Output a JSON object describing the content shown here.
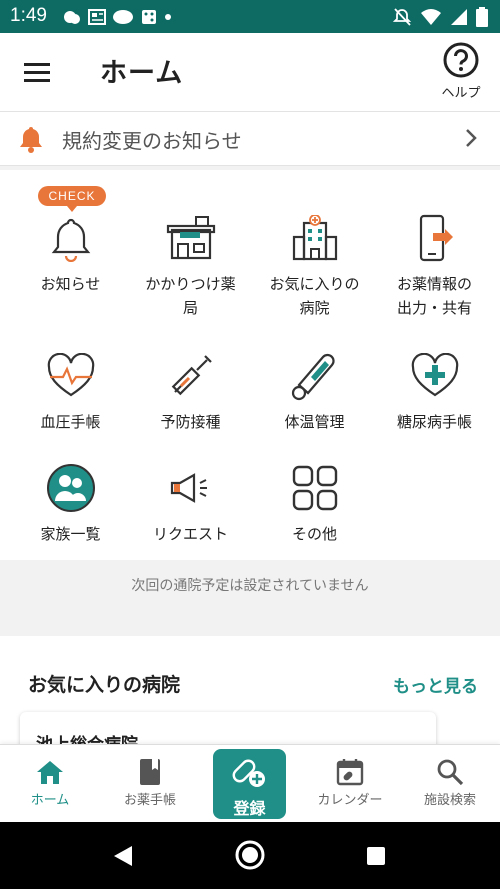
{
  "status_bar": {
    "time": "1:49"
  },
  "app_bar": {
    "title": "ホーム",
    "help_label": "ヘルプ"
  },
  "notice": {
    "text": "規約変更のお知らせ"
  },
  "check_badge": "CHECK",
  "menu": {
    "items": [
      {
        "label": "お知らせ",
        "icon": "bell-icon"
      },
      {
        "label": "かかりつけ薬\n局",
        "icon": "pharmacy-icon"
      },
      {
        "label": "お気に入りの\n病院",
        "icon": "hospital-icon"
      },
      {
        "label": "お薬情報の\n出力・共有",
        "icon": "share-phone-icon"
      },
      {
        "label": "血圧手帳",
        "icon": "heart-pulse-icon"
      },
      {
        "label": "予防接種",
        "icon": "syringe-icon"
      },
      {
        "label": "体温管理",
        "icon": "thermometer-icon"
      },
      {
        "label": "糖尿病手帳",
        "icon": "heart-plus-icon"
      },
      {
        "label": "家族一覧",
        "icon": "family-icon"
      },
      {
        "label": "リクエスト",
        "icon": "megaphone-icon"
      },
      {
        "label": "その他",
        "icon": "grid-icon"
      }
    ]
  },
  "next_visit": "次回の通院予定は設定されていません",
  "favorites": {
    "heading": "お気に入りの病院",
    "more_label": "もっと見る",
    "hospital": "池上総合病院"
  },
  "bottom_nav": {
    "home": "ホーム",
    "notebook": "お薬手帳",
    "register": "登録",
    "calendar": "カレンダー",
    "search": "施設検索"
  },
  "colors": {
    "teal": "#1f8f87",
    "status": "#0e6b64",
    "accent": "#e8763a"
  }
}
